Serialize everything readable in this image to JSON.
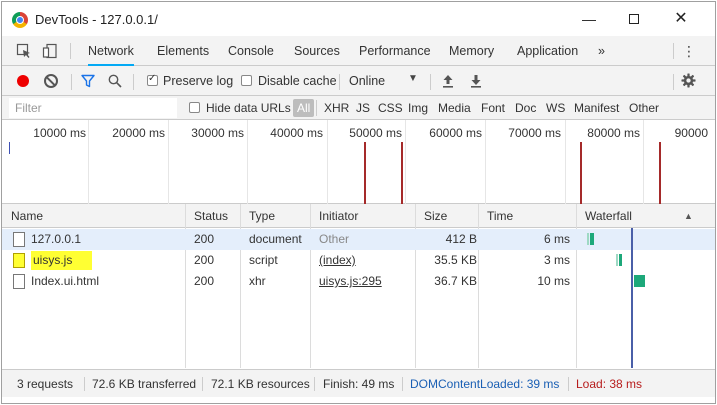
{
  "window": {
    "title": "DevTools - 127.0.0.1/"
  },
  "tabs": [
    {
      "label": "Network",
      "active": true
    },
    {
      "label": "Elements"
    },
    {
      "label": "Console"
    },
    {
      "label": "Sources"
    },
    {
      "label": "Performance"
    },
    {
      "label": "Memory"
    },
    {
      "label": "Application"
    },
    {
      "label": "»"
    }
  ],
  "toolbar": {
    "preserve_log": "Preserve log",
    "preserve_log_checked": true,
    "disable_cache": "Disable cache",
    "disable_cache_checked": false,
    "throttle": "Online"
  },
  "filter": {
    "placeholder": "Filter",
    "hide_data_urls": "Hide data URLs",
    "types": [
      "All",
      "XHR",
      "JS",
      "CSS",
      "Img",
      "Media",
      "Font",
      "Doc",
      "WS",
      "Manifest",
      "Other"
    ]
  },
  "overview": {
    "ticks": [
      "10000 ms",
      "20000 ms",
      "30000 ms",
      "40000 ms",
      "50000 ms",
      "60000 ms",
      "70000 ms",
      "80000 ms",
      "90000"
    ]
  },
  "table": {
    "headers": {
      "name": "Name",
      "status": "Status",
      "type": "Type",
      "initiator": "Initiator",
      "size": "Size",
      "time": "Time",
      "waterfall": "Waterfall"
    },
    "rows": [
      {
        "name": "127.0.0.1",
        "status": "200",
        "type": "document",
        "initiator": "Other",
        "size": "412 B",
        "time": "6 ms"
      },
      {
        "name": "uisys.js",
        "status": "200",
        "type": "script",
        "initiator": "(index)",
        "size": "35.5 KB",
        "time": "3 ms"
      },
      {
        "name": "Index.ui.html",
        "status": "200",
        "type": "xhr",
        "initiator": "uisys.js:295",
        "size": "36.7 KB",
        "time": "10 ms"
      }
    ]
  },
  "status": {
    "requests": "3 requests",
    "transferred": "72.6 KB transferred",
    "resources": "72.1 KB resources",
    "finish": "Finish: 49 ms",
    "dcl": "DOMContentLoaded: 39 ms",
    "load": "Load: 38 ms"
  },
  "colors": {
    "accent": "#03a9f4",
    "record": "#ee0000",
    "dcl": "#1a5fb4",
    "load": "#b71c1c",
    "highlight": "#ffff33"
  }
}
